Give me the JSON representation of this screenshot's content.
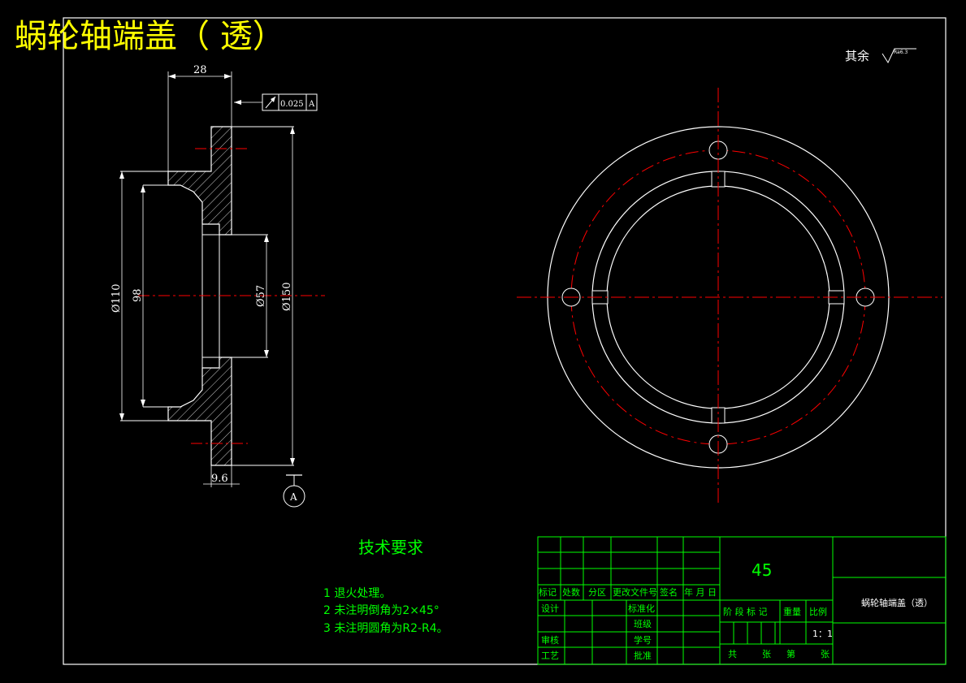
{
  "drawing": {
    "title": "蜗轮轴端盖（ 透）",
    "surface_note": "其余",
    "roughness_symbol": "Ra6.3"
  },
  "dimensions": {
    "width_28": "28",
    "flange_9_6": "9.6",
    "d110": "Ø110",
    "d98": "98",
    "d57": "Ø57",
    "d150": "Ø150",
    "tolerance_value": "0.025",
    "tolerance_datum": "A",
    "datum_label": "A"
  },
  "tech": {
    "heading": "技术要求",
    "items": [
      "1 退火处理。",
      "2 未注明倒角为2×45°",
      "3 未注明圆角为R2-R4。"
    ]
  },
  "titleblock": {
    "material": "45",
    "part_name": "蜗轮轴端盖（透）",
    "row_labels": [
      "标记",
      "处数",
      "分区",
      "更改文件号",
      "签名",
      "年 月 日"
    ],
    "design": "设计",
    "standardize": "标准化",
    "check": "审核",
    "process": "工艺",
    "class": "班级",
    "student_no": "学号",
    "approve": "批准",
    "stage_labels": [
      "阶 段 标 记",
      "重量",
      "比例"
    ],
    "scale": "1：1",
    "sheet_labels": [
      "共",
      "张",
      "第",
      "张"
    ]
  },
  "colors": {
    "title": "#ffff00",
    "line": "#ffffff",
    "center": "#ff0000",
    "text_green": "#00ff00"
  }
}
